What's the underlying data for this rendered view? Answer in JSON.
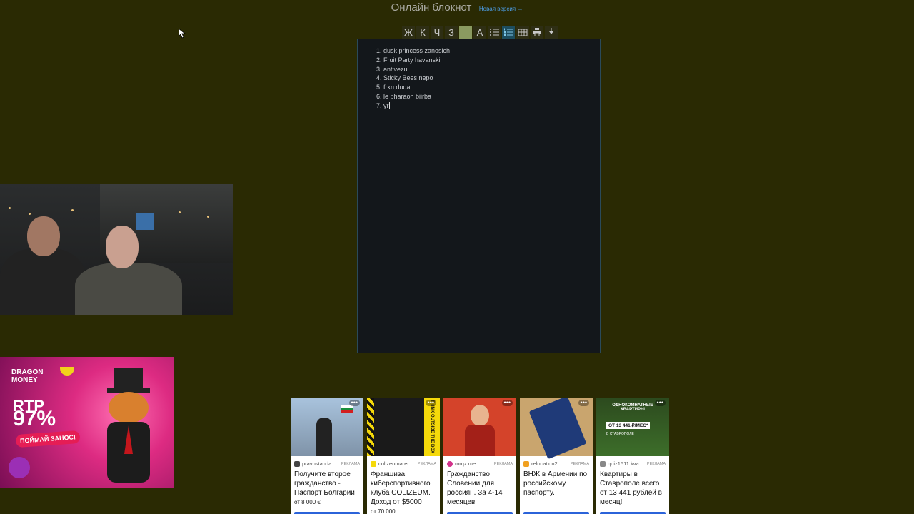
{
  "header": {
    "title": "Онлайн блокнот",
    "new_version_link": "Новая версия →"
  },
  "toolbar": {
    "bold": "Ж",
    "italic": "К",
    "underline": "Ч",
    "strike": "З",
    "font_color": "A"
  },
  "editor": {
    "items": [
      "dusk princess zanosich",
      "Fruit Party havanski",
      "antivezu",
      "Sticky Bees nepo",
      "frkn duda",
      "le pharaoh biirba",
      "yr"
    ]
  },
  "promo": {
    "brand_line1": "DRAGON",
    "brand_line2": "MONEY",
    "rtp": "RTP",
    "percent": "97%",
    "cta": "ПОЙМАЙ ЗАНОС!"
  },
  "ads": [
    {
      "source": "pravostanda",
      "label": "РЕКЛАМА",
      "title": "Получите второе гражданство - Паспорт Болгарии",
      "price": "от 8 000 €"
    },
    {
      "source": "colizeumarer",
      "label": "РЕКЛАМА",
      "title": "Франшиза киберспортивного клуба COLIZEUM. Доход от $5000",
      "price": "от 70 000"
    },
    {
      "source": "mrqz.me",
      "label": "РЕКЛАМА",
      "title": "Гражданство Словении для россиян. За 4-14 месяцев",
      "price": ""
    },
    {
      "source": "relocation2i",
      "label": "РЕКЛАМА",
      "title": "ВНЖ в Армении по российскому паспорту.",
      "price": ""
    },
    {
      "source": "quiz1511.kva",
      "label": "РЕКЛАМА",
      "title": "Квартиры в Ставрополе всего от 13 441 рублей в месяц!",
      "price": ""
    }
  ],
  "ad_image_text": {
    "ad2_banner": "THINK OUTSIDE THE BOX",
    "ad5_header": "ОДНОКОМНАТНЫЕ КВАРТИРЫ",
    "ad5_price": "ОТ 13 441 ₽/МЕС*",
    "ad5_city": "В СТАВРОПОЛЕ"
  },
  "colors": {
    "page_bg": "#2a2a03",
    "editor_bg": "#13171b",
    "link": "#4d9fe8",
    "ad_button": "#2b63d9"
  }
}
